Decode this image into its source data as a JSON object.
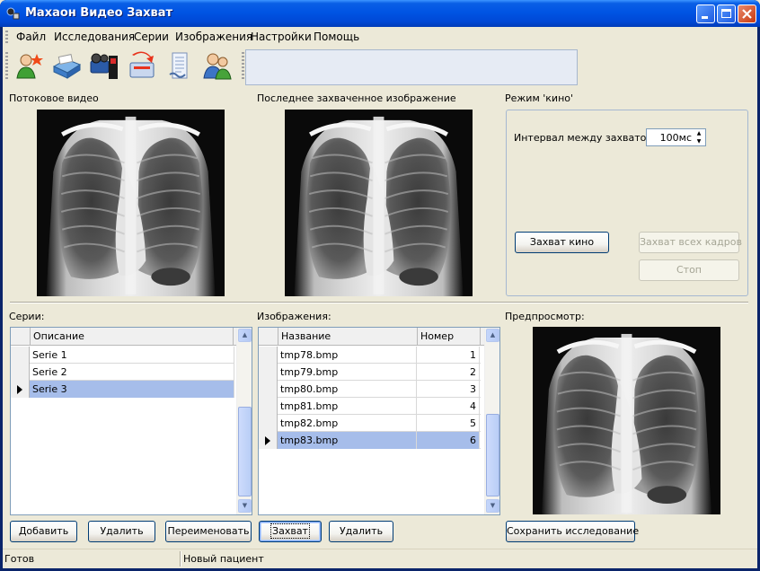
{
  "window": {
    "title": "Махаон Видео Захват"
  },
  "menu": [
    "Файл",
    "Исследования",
    "Серии",
    "Изображения",
    "Настройки",
    "Помощь"
  ],
  "toolbar": {
    "tools": [
      "new-patient-icon",
      "scanner-icon",
      "video-camera-icon",
      "export-icon",
      "document-icon",
      "users-icon"
    ]
  },
  "video": {
    "stream_label": "Потоковое видео",
    "last_label": "Последнее захваченное изображение"
  },
  "cine": {
    "group_label": "Режим 'кино'",
    "interval_label": "Интервал между захватом:",
    "interval_value": "100мс",
    "capture_cine": "Захват кино",
    "capture_all": "Захват всех кадров",
    "stop": "Стоп"
  },
  "series": {
    "label": "Серии:",
    "column": "Описание",
    "rows": [
      "Serie 1",
      "Serie 2",
      "Serie 3"
    ],
    "selected": 2,
    "add": "Добавить",
    "delete": "Удалить",
    "rename": "Переименовать"
  },
  "images": {
    "label": "Изображения:",
    "columns": [
      "Название",
      "Номер"
    ],
    "rows": [
      {
        "name": "tmp78.bmp",
        "num": "1"
      },
      {
        "name": "tmp79.bmp",
        "num": "2"
      },
      {
        "name": "tmp80.bmp",
        "num": "3"
      },
      {
        "name": "tmp81.bmp",
        "num": "4"
      },
      {
        "name": "tmp82.bmp",
        "num": "5"
      },
      {
        "name": "tmp83.bmp",
        "num": "6"
      }
    ],
    "selected": 5,
    "capture": "Захват",
    "delete": "Удалить"
  },
  "preview": {
    "label": "Предпросмотр:",
    "save": "Сохранить исследование"
  },
  "status": {
    "left": "Готов",
    "right": "Новый пациент"
  },
  "colors": {
    "titlebar": "#0054E3",
    "selection": "#A6BDEA",
    "face": "#ECE9D8"
  }
}
